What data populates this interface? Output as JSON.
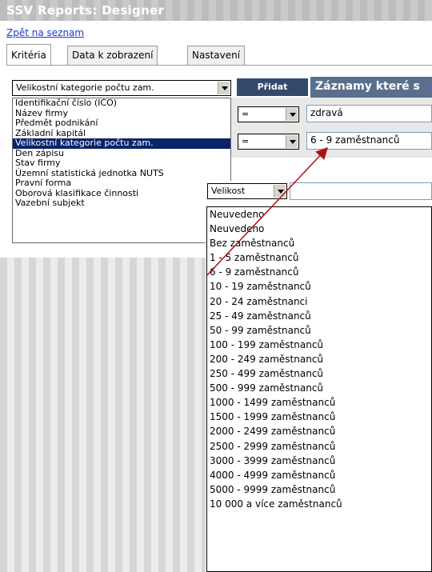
{
  "app": {
    "title": "SSV Reports: Designer",
    "back_link": "Zpět na seznam"
  },
  "tabs": [
    "Kritéria",
    "Data k zobrazení",
    "Nastavení"
  ],
  "criteria": {
    "field_select_value": "Velikostní kategorie počtu zam.",
    "add_button": "Přidat",
    "records_header": "Záznamy které s",
    "field_list": [
      "Identifikační číslo (IČO)",
      "Název firmy",
      "Předmět podnikání",
      "Základní kapitál",
      "Velikostní kategorie počtu zam.",
      "Den zápisu",
      "Stav firmy",
      "Územní statistická jednotka NUTS",
      "Pravní forma",
      "Oborová klasifikace činnosti",
      "Vazební subjekt"
    ],
    "selected_field_index": 4,
    "rows": [
      {
        "operator": "=",
        "value": "zdravá"
      },
      {
        "operator": "=",
        "value": "6 - 9 zaměstnanců"
      }
    ]
  },
  "popup": {
    "select_value": "Velikost",
    "options": [
      "Neuvedeno",
      "Neuvedeno",
      "Bez zaměstnanců",
      "1 - 5 zaměstnanců",
      "6 - 9 zaměstnanců",
      "10 - 19 zaměstnanců",
      "20 - 24 zaměstnanci",
      "25 - 49 zaměstnanců",
      "50 - 99 zaměstnanců",
      "100 - 199 zaměstnanců",
      "200 - 249 zaměstnanců",
      "250 - 499 zaměstnanců",
      "500 - 999 zaměstnanců",
      "1000 - 1499 zaměstnanců",
      "1500 - 1999 zaměstnanců",
      "2000 - 2499 zaměstnanců",
      "2500 - 2999 zaměstnanců",
      "3000 - 3999 zaměstnanců",
      "4000 - 4999 zaměstnanců",
      "5000 - 9999 zaměstnanců",
      "10 000 a více zaměstnanců"
    ]
  },
  "colors": {
    "annotation_arrow": "#b01010",
    "selection": "#0a246a",
    "header": "#5a6f8e",
    "button": "#334a6d"
  }
}
